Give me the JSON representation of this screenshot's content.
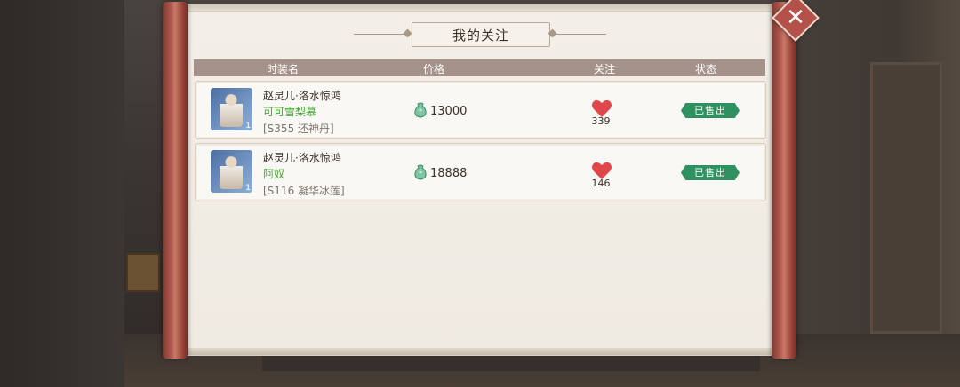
{
  "dialog": {
    "title": "我的关注",
    "close_icon": "close-icon"
  },
  "table": {
    "headers": [
      "时装名",
      "价格",
      "关注",
      "状态"
    ],
    "rows": [
      {
        "item_name": "赵灵儿·洛水惊鸿",
        "seller": "可可雪梨慕",
        "server": "[S355 还神丹]",
        "quantity": "1",
        "price": "13000",
        "likes": "339",
        "status": "已售出"
      },
      {
        "item_name": "赵灵儿·洛水惊鸿",
        "seller": "阿奴",
        "server": "[S116 凝华冰莲]",
        "quantity": "1",
        "price": "18888",
        "likes": "146",
        "status": "已售出"
      }
    ]
  },
  "colors": {
    "accent_green": "#2f9160",
    "seller_green": "#47a335",
    "heart_red": "#e0474b",
    "header_bar": "#a4928a"
  }
}
